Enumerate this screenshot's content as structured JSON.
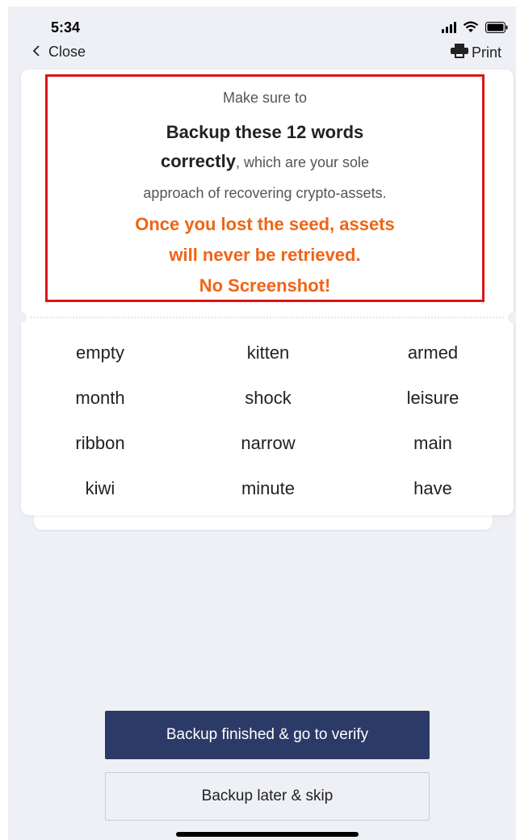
{
  "status": {
    "time": "5:34"
  },
  "nav": {
    "close_label": "Close",
    "print_label": "Print",
    "back_icon": "chevron-left-icon",
    "print_icon": "printer-icon"
  },
  "warning": {
    "line1": "Make sure to",
    "line2": "Backup these 12 words",
    "line3_bold": "correctly",
    "line3_rest": ", which are your sole",
    "line4": "approach of recovering crypto-assets.",
    "line5": "Once you lost the seed, assets",
    "line6": "will never be retrieved.",
    "line7": "No Screenshot!"
  },
  "seed_words": [
    [
      "empty",
      "kitten",
      "armed"
    ],
    [
      "month",
      "shock",
      "leisure"
    ],
    [
      "ribbon",
      "narrow",
      "main"
    ],
    [
      "kiwi",
      "minute",
      "have"
    ]
  ],
  "buttons": {
    "verify_label": "Backup finished & go to verify",
    "skip_label": "Backup later & skip"
  },
  "colors": {
    "accent_warning": "#f06414",
    "highlight_border": "#e01414",
    "primary_button": "#2b3a67"
  }
}
